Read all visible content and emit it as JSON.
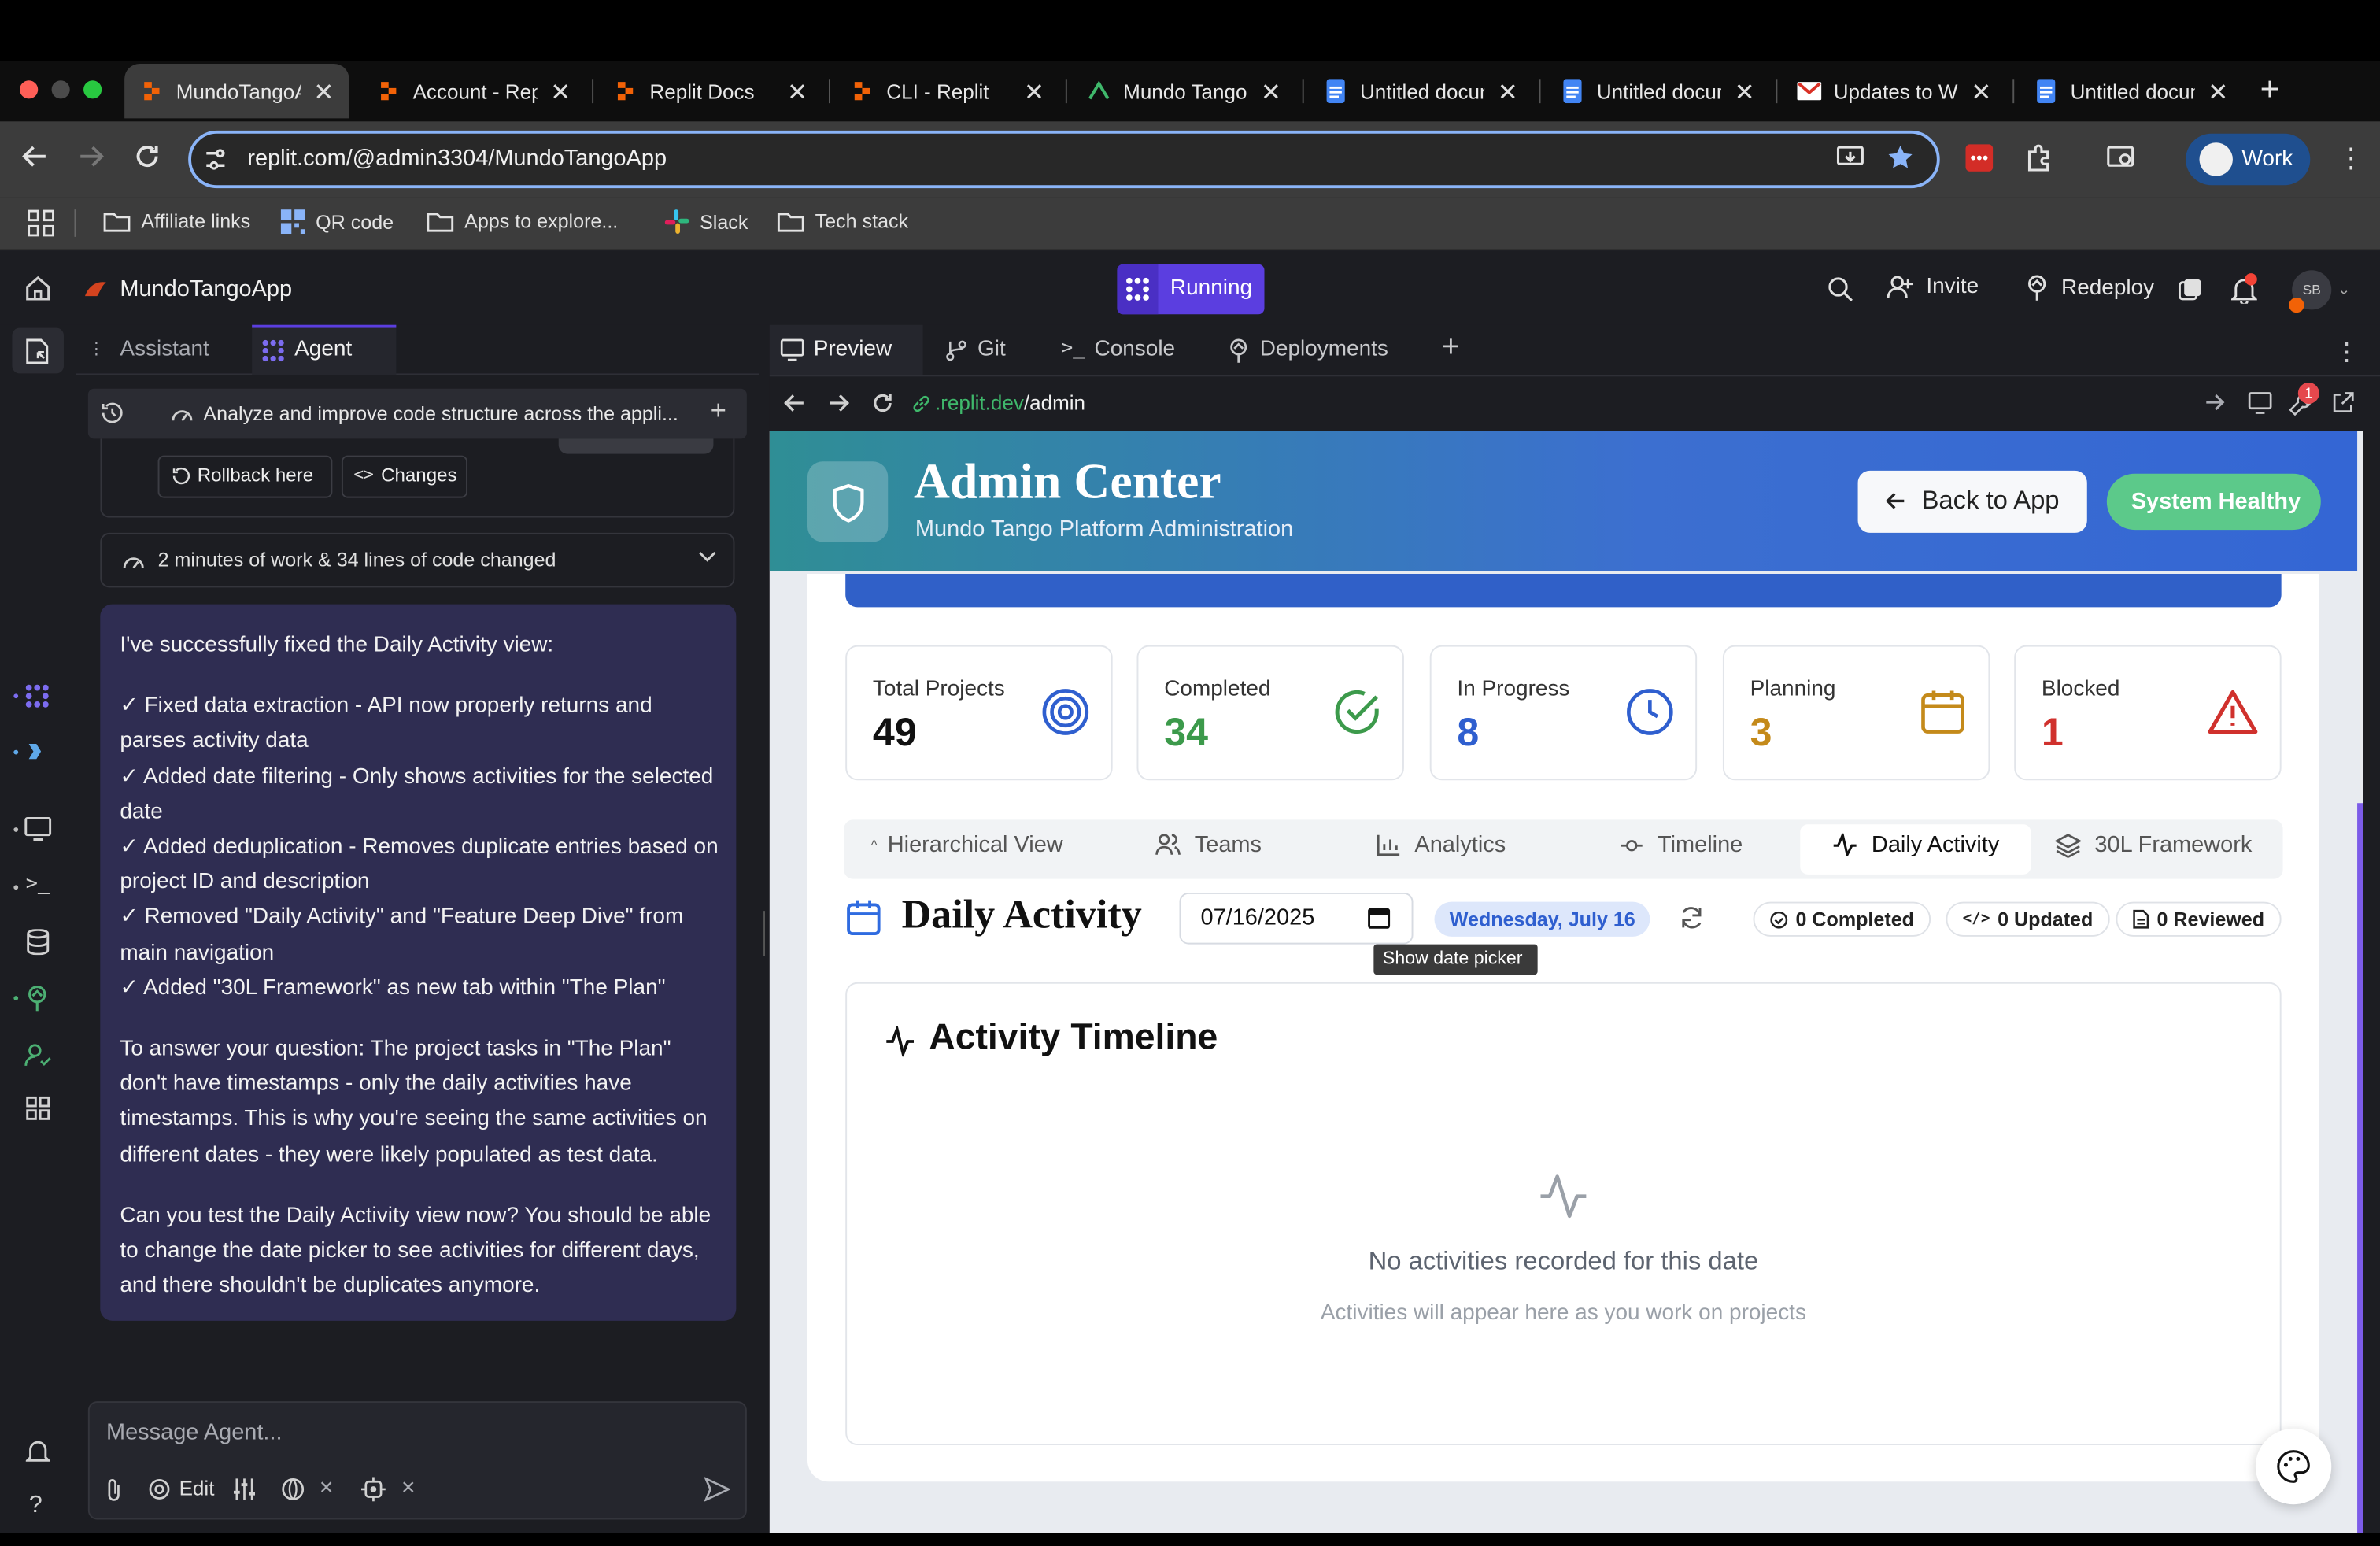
{
  "browser": {
    "tabs": [
      {
        "title": "MundoTangoApp",
        "active": true
      },
      {
        "title": "Account - Replit"
      },
      {
        "title": "Replit Docs"
      },
      {
        "title": "CLI - Replit"
      },
      {
        "title": "Mundo Tango"
      },
      {
        "title": "Untitled document"
      },
      {
        "title": "Untitled document"
      },
      {
        "title": "Updates to W"
      },
      {
        "title": "Untitled document"
      }
    ],
    "url": "replit.com/@admin3304/MundoTangoApp",
    "profile": "Work",
    "bookmarks": [
      "Affiliate links",
      "QR code",
      "Apps to explore...",
      "Slack",
      "Tech stack"
    ]
  },
  "replit": {
    "app_name": "MundoTangoApp",
    "run_status": "Running",
    "invite_label": "Invite",
    "redeploy_label": "Redeploy",
    "avatar_initials": "SB",
    "left_tabs": [
      "Assistant",
      "Agent"
    ],
    "thread_title": "Analyze and improve code structure across the appli...",
    "rollback_label": "Rollback here",
    "changes_label": "Changes",
    "work_summary": "2 minutes of work & 34 lines of code changed",
    "message": {
      "intro": "I've successfully fixed the Daily Activity view:",
      "bullets": [
        "✓ Fixed data extraction - API now properly returns and parses activity data",
        "✓ Added date filtering - Only shows activities for the selected date",
        "✓ Added deduplication - Removes duplicate entries based on project ID and description",
        "✓ Removed \"Daily Activity\" and \"Feature Deep Dive\" from main navigation",
        "✓ Added \"30L Framework\" as new tab within \"The Plan\""
      ],
      "para2": "To answer your question: The project tasks in \"The Plan\" don't have timestamps - only the daily activities have timestamps. This is why you're seeing the same activities on different dates - they were likely populated as test data.",
      "para3": "Can you test the Daily Activity view now? You should be able to change the date picker to see activities for different days, and there shouldn't be duplicates anymore."
    },
    "input_placeholder": "Message Agent...",
    "edit_label": "Edit",
    "right_tabs": [
      "Preview",
      "Git",
      "Console",
      "Deployments"
    ],
    "preview_url_prefix": ".replit.dev",
    "preview_url_path": "/admin",
    "notif_count": "1"
  },
  "admin": {
    "title": "Admin Center",
    "subtitle": "Mundo Tango Platform Administration",
    "back_label": "Back to App",
    "health_label": "System Healthy",
    "stats": [
      {
        "label": "Total Projects",
        "value": "49",
        "color": "#111111"
      },
      {
        "label": "Completed",
        "value": "34",
        "color": "#3c9a4b"
      },
      {
        "label": "In Progress",
        "value": "8",
        "color": "#2f5fcf"
      },
      {
        "label": "Planning",
        "value": "3",
        "color": "#c48a1a"
      },
      {
        "label": "Blocked",
        "value": "1",
        "color": "#d0312d"
      }
    ],
    "tabs": [
      "Hierarchical View",
      "Teams",
      "Analytics",
      "Timeline",
      "Daily Activity",
      "30L Framework"
    ],
    "active_tab": "Daily Activity",
    "section_title": "Daily Activity",
    "date_value": "07/16/2025",
    "date_label": "Wednesday, July 16",
    "tooltip": "Show date picker",
    "chips": [
      "0 Completed",
      "0 Updated",
      "0 Reviewed"
    ],
    "timeline_title": "Activity Timeline",
    "empty_title": "No activities recorded for this date",
    "empty_sub": "Activities will appear here as you work on projects"
  }
}
